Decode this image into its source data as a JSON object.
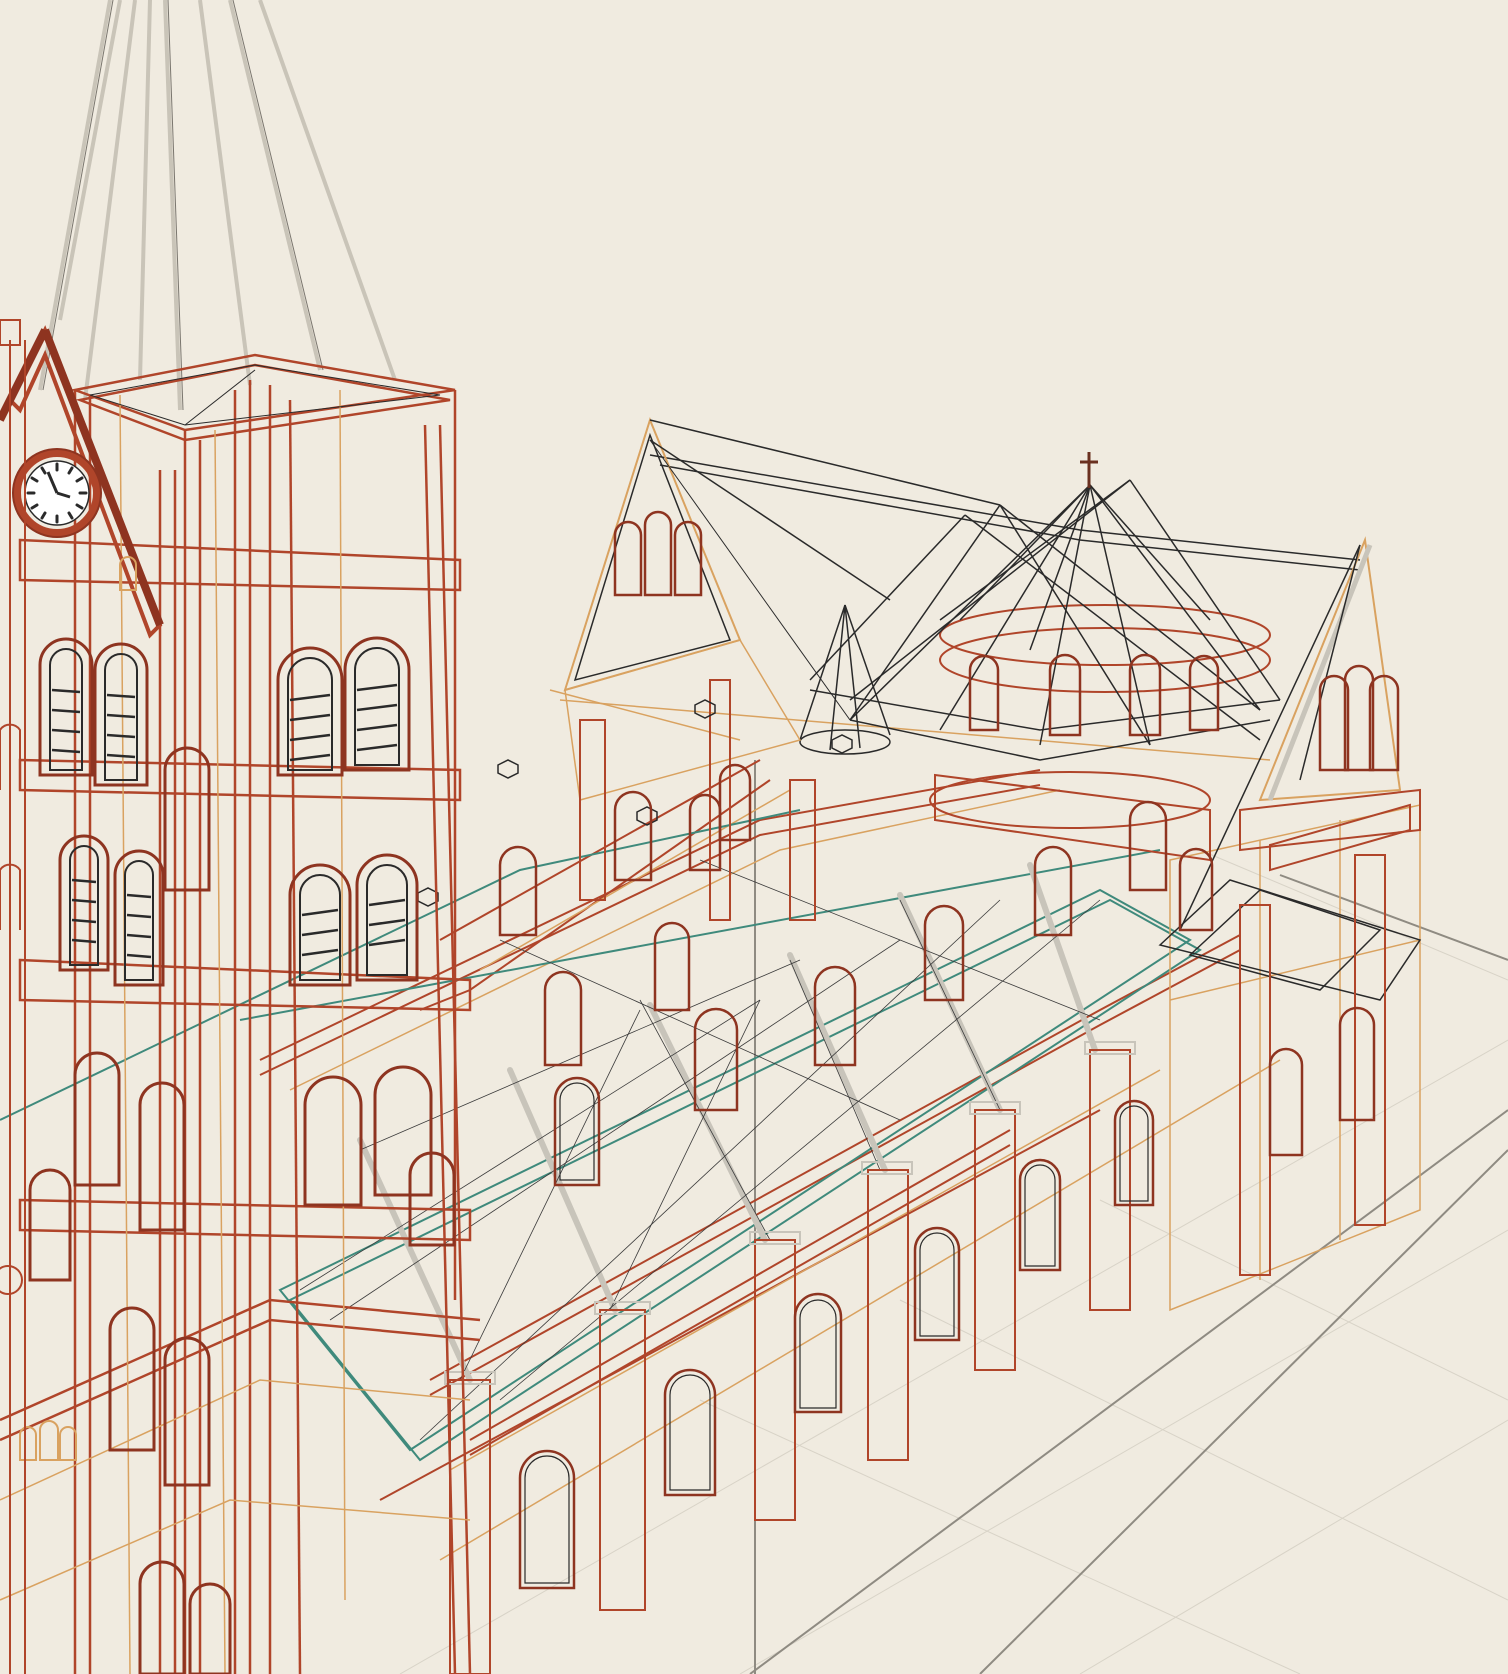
{
  "viewport": {
    "mode": "wireframe",
    "subject": "cathedral-model",
    "colors": {
      "background": "#f0ebe0",
      "brick": "#b0452a",
      "brick_dark": "#8e3420",
      "sand": "#d9a260",
      "dark": "#2a2a2a",
      "teal": "#3f8a7c",
      "steel": "#c8c4ba",
      "ground": "#d8d3c7"
    }
  }
}
